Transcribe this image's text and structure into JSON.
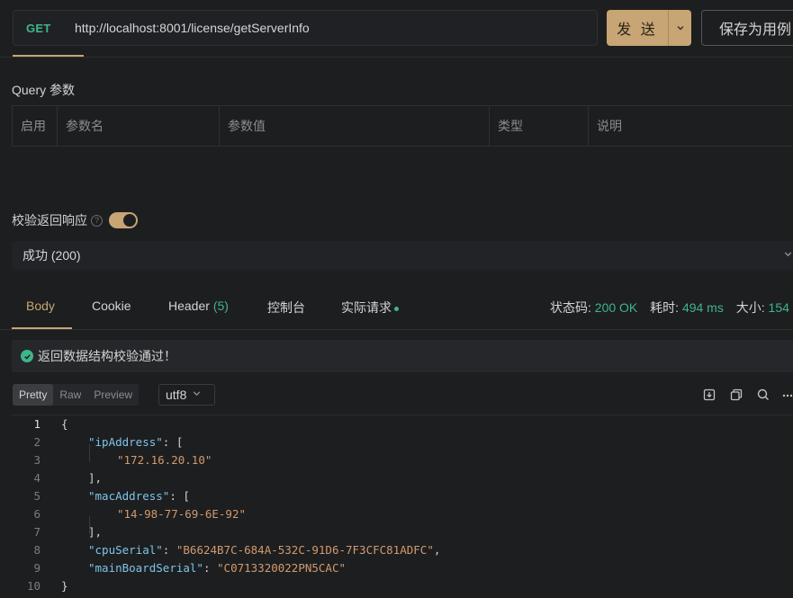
{
  "request": {
    "method": "GET",
    "url": "http://localhost:8001/license/getServerInfo",
    "send_label": "发 送",
    "save_label": "保存为用例"
  },
  "query": {
    "title": "Query 参数",
    "columns": [
      "启用",
      "参数名",
      "参数值",
      "类型",
      "说明"
    ]
  },
  "validate": {
    "label": "校验返回响应",
    "help_icon": "help-circle-icon",
    "toggle_on": true,
    "selected": "成功 (200)"
  },
  "response_tabs": {
    "body": "Body",
    "cookie": "Cookie",
    "header": "Header",
    "header_count": "(5)",
    "console": "控制台",
    "actual_request": "实际请求"
  },
  "status": {
    "code_label": "状态码:",
    "code_value": "200 OK",
    "time_label": "耗时:",
    "time_value": "494 ms",
    "size_label": "大小:",
    "size_value": "154"
  },
  "banner": {
    "icon": "check-circle-icon",
    "text": "返回数据结构校验通过！"
  },
  "format": {
    "modes": [
      "Pretty",
      "Raw",
      "Preview"
    ],
    "active_mode": "Pretty",
    "encoding": "utf8",
    "tools": [
      "download-icon",
      "copy-icon",
      "search-icon",
      "more-icon"
    ]
  },
  "code": {
    "active_line": 1,
    "lines": [
      {
        "n": "1",
        "text": "{"
      },
      {
        "n": "2",
        "key": "ipAddress",
        "rest": ": ["
      },
      {
        "n": "3",
        "str": "172.16.20.10"
      },
      {
        "n": "4",
        "text": "],"
      },
      {
        "n": "5",
        "key": "macAddress",
        "rest": ": ["
      },
      {
        "n": "6",
        "str": "14-98-77-69-6E-92"
      },
      {
        "n": "7",
        "text": "],"
      },
      {
        "n": "8",
        "key": "cpuSerial",
        "rest": ": ",
        "str": "B6624B7C-684A-532C-91D6-7F3CFC81ADFC",
        "tail": ","
      },
      {
        "n": "9",
        "key": "mainBoardSerial",
        "rest": ": ",
        "str": "C0713320022PN5CAC"
      },
      {
        "n": "10",
        "text": "}"
      }
    ]
  },
  "colors": {
    "accent": "#c7a574",
    "success": "#3fb58a",
    "json_key": "#7fc4e8",
    "json_string": "#d19a6d",
    "background": "#1d1e20"
  }
}
